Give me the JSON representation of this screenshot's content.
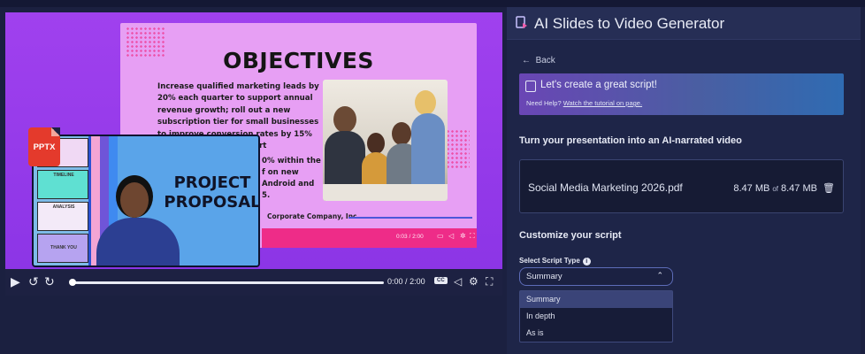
{
  "player": {
    "slide": {
      "title": "OBJECTIVES",
      "body": "Increase qualified marketing leads by 20% each quarter to support annual revenue growth; roll out a new subscription tier for small businesses to improve conversion rates by 15% next quarter.  Cut support",
      "footer": "Corporate Company, Inc.",
      "time": "0:03 / 2:00"
    },
    "overlay": {
      "title_line1": "PROJECT",
      "title_line2": "PROPOSAL",
      "thumbs": [
        "",
        "TIMELINE",
        "ANALYSIS",
        "THANK YOU"
      ],
      "partial_text_1": "Android and",
      "partial_text_2": "5.",
      "partial_text_3": "0% within the",
      "partial_text_4": "f on new"
    },
    "badge": "PPTX",
    "controls": {
      "time_current": "0:00",
      "time_separator": "/",
      "time_total": "2:00",
      "cc_label": "CC",
      "progress": 0
    }
  },
  "panel": {
    "title": "AI Slides to Video Generator",
    "back_label": "Back",
    "hero": {
      "heading": "Let's create a great script!",
      "help_prefix": "Need Help?",
      "help_link": "Watch the tutorial on page."
    },
    "section_video": "Turn your presentation into an AI-narrated video",
    "file": {
      "name": "Social Media Marketing 2026.pdf",
      "uploaded": "8.47 MB",
      "of": "of",
      "total": "8.47 MB"
    },
    "section_customize": "Customize your script",
    "script_type_label": "Select Script Type",
    "selected": "Summary",
    "options": [
      "Summary",
      "In depth",
      "As is"
    ]
  },
  "colors": {
    "stage_purple": "#9a3ff0",
    "slide_pink": "#e79ff4",
    "accent_pink": "#ee2c88",
    "panel_bg": "#1e2548",
    "hero_gradient_start": "#6a46b5",
    "badge_red": "#e43a2c"
  }
}
